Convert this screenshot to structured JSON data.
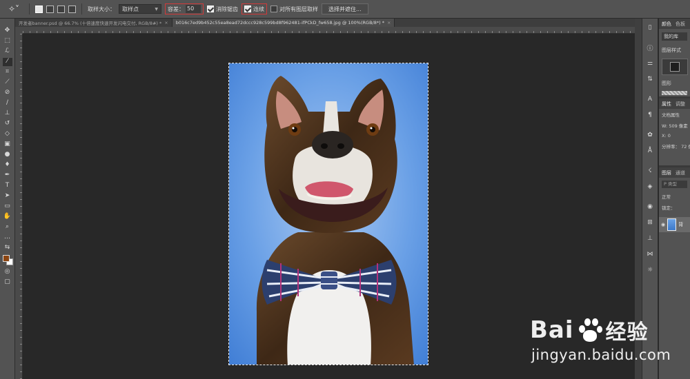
{
  "options_bar": {
    "sample_size_label": "取样大小：",
    "sample_size_value": "取样点",
    "tolerance_label": "容差：",
    "tolerance_value": "50",
    "anti_alias_label": "消除锯齿",
    "contiguous_label": "连续",
    "sample_all_layers_label": "对所有图层取样",
    "select_mask_button": "选择并遮住..."
  },
  "tabs": [
    {
      "label": "开发者banner.psd @ 66.7% (十倍速度快速开发闪电交付, RGB/8#) *",
      "close": "×"
    },
    {
      "label": "b016c7ed9b452c55ea8ead72dccc928c599bd8f962481-ifPCkD_fw658.jpg @ 100%(RGB/8*) *",
      "close": "×"
    }
  ],
  "right_panel": {
    "top_tabs": [
      "颜色",
      "色板"
    ],
    "library_select": "我的库",
    "layer_style_label": "图层样式",
    "graphics_label": "图形",
    "props_tabs": [
      "属性",
      "调整"
    ],
    "doc_props_label": "文档属性",
    "width_label": "W:",
    "width_value": "509 像素",
    "x_label": "X:",
    "x_value": "0",
    "resolution_label": "分辨率：",
    "resolution_value": "72 像素",
    "layers_tabs": [
      "图层",
      "通道"
    ],
    "search_placeholder": "P 类型",
    "blend_mode": "正常",
    "lock_label": "锁定：",
    "layer_name": "背"
  },
  "watermark": {
    "logo_prefix": "Bai",
    "logo_suffix": "经验",
    "url": "jingyan.baidu.com"
  },
  "colors": {
    "foreground": "#8c4511",
    "background": "#ffffff",
    "photo_backdrop": "#4a86d8"
  }
}
